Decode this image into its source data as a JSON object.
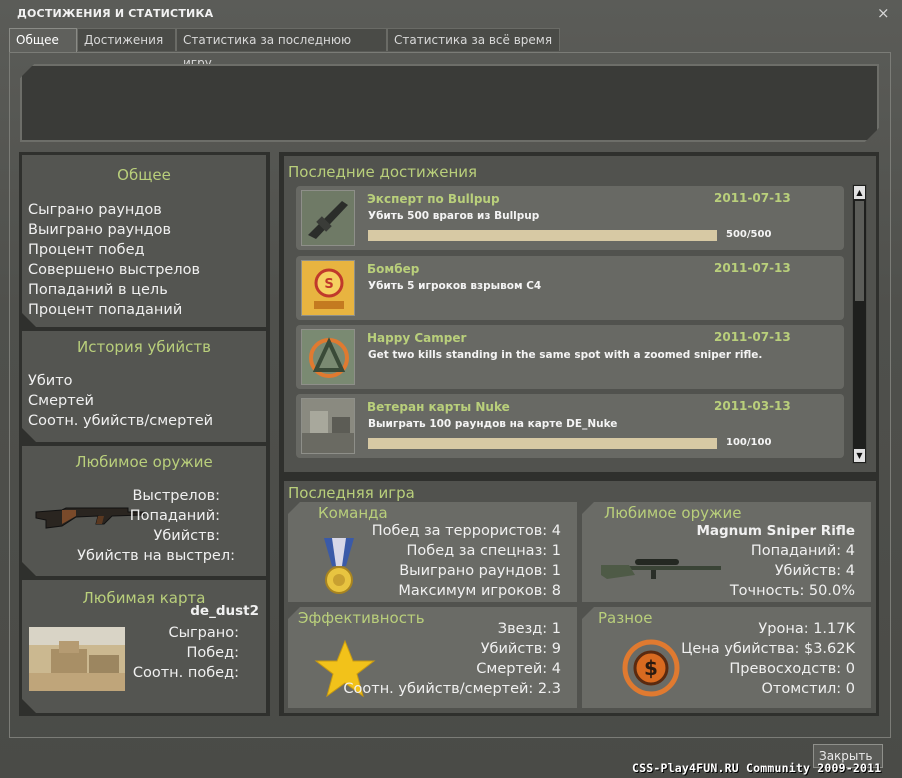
{
  "window": {
    "title": "ДОСТИЖЕНИЯ И СТАТИСТИКА",
    "close_icon": "×"
  },
  "tabs": [
    {
      "label": "Общее",
      "active": true
    },
    {
      "label": "Достижения",
      "active": false
    },
    {
      "label": "Статистика за последнюю игру",
      "active": false
    },
    {
      "label": "Статистика за всё время",
      "active": false
    }
  ],
  "left": {
    "general": {
      "title": "Общее",
      "lines": [
        "Сыграно раундов",
        "Выиграно раундов",
        "Процент побед",
        "Совершено выстрелов",
        "Попаданий в цель",
        "Процент попаданий"
      ]
    },
    "kills": {
      "title": "История убийств",
      "lines": [
        "Убито",
        "Смертей",
        "Соотн. убийств/смертей"
      ]
    },
    "weapon": {
      "title": "Любимое оружие",
      "lines": [
        "Выстрелов:",
        "Попаданий:",
        "Убийств:",
        "Убийств на выстрел:"
      ]
    },
    "map": {
      "title": "Любимая карта",
      "name": "de_dust2",
      "lines": [
        "Сыграно:",
        "Побед:",
        "Соотн. побед:"
      ]
    }
  },
  "achievements": {
    "title": "Последние достижения",
    "items": [
      {
        "name": "Эксперт по Bullpup",
        "desc": "Убить 500 врагов из Bullpup",
        "date": "2011-07-13",
        "progress_text": "500/500",
        "progress": 1.0,
        "icon": "rifle-icon"
      },
      {
        "name": "Бомбер",
        "desc": "Убить 5 игроков взрывом C4",
        "date": "2011-07-13",
        "progress_text": "",
        "progress": null,
        "icon": "bomb-icon"
      },
      {
        "name": "Happy Camper",
        "desc": "Get two kills standing in the same spot with a zoomed sniper rifle.",
        "date": "2011-07-13",
        "progress_text": "",
        "progress": null,
        "icon": "camper-icon"
      },
      {
        "name": "Ветеран карты Nuke",
        "desc": "Выиграть 100 раундов на карте DE_Nuke",
        "date": "2011-03-13",
        "progress_text": "100/100",
        "progress": 1.0,
        "icon": "map-nuke-icon"
      }
    ]
  },
  "last_game": {
    "title": "Последняя игра",
    "team": {
      "title": "Команда",
      "lines": [
        "Побед за террористов: 4",
        "Побед за спецназ: 1",
        "Выиграно раундов: 1",
        "Максимум игроков: 8"
      ]
    },
    "weapon": {
      "title": "Любимое оружие",
      "name": "Magnum Sniper Rifle",
      "lines": [
        "Попаданий: 4",
        "Убийств: 4",
        "Точность: 50.0%"
      ]
    },
    "efficiency": {
      "title": "Эффективность",
      "lines": [
        "Звезд: 1",
        "Убийств: 9",
        "Смертей: 4",
        "Соотн. убийств/смертей: 2.3"
      ]
    },
    "misc": {
      "title": "Разное",
      "lines": [
        "Урона: 1.17K",
        "Цена убийства: $3.62K",
        "Превосходств: 0",
        "Отомстил: 0"
      ]
    }
  },
  "buttons": {
    "close": "Закрыть"
  },
  "footer": "CSS-Play4FUN.RU Community 2009-2011"
}
